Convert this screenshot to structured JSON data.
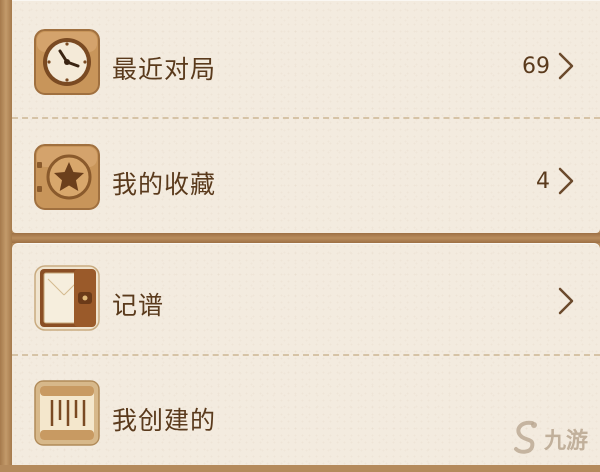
{
  "sections": [
    {
      "items": [
        {
          "label": "最近对局",
          "count": "69",
          "icon": "clock-icon"
        },
        {
          "label": "我的收藏",
          "count": "4",
          "icon": "star-badge-icon"
        }
      ]
    },
    {
      "items": [
        {
          "label": "记谱",
          "count": "",
          "icon": "book-icon"
        },
        {
          "label": "我创建的",
          "count": "",
          "icon": "board-icon"
        }
      ]
    }
  ],
  "watermark": {
    "text": "九游",
    "icon": "swirl-logo-icon"
  },
  "colors": {
    "text": "#5a3a1c",
    "panel": "#f3ebdf",
    "wood": "#b48a5c",
    "icon_wood": "#c8955a"
  }
}
